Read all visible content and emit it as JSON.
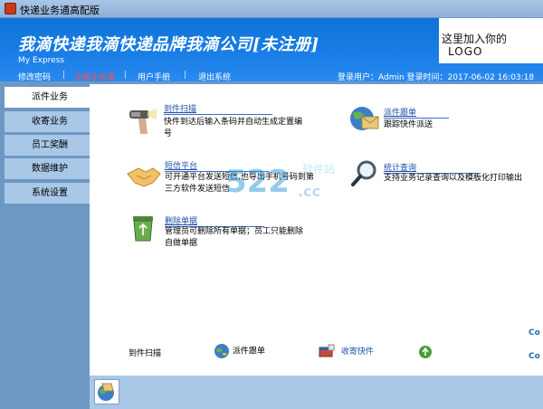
{
  "window": {
    "title": "快递业务通高配版"
  },
  "header": {
    "app_title": "我滴快递我滴快递品牌我滴公司[未注册]",
    "subtitle": "My Express",
    "logo_line1": "这里加入你的",
    "logo_line2": "LOGO"
  },
  "menu": {
    "items": [
      "修改密码",
      "注册业务通",
      "用户手册",
      "退出系统"
    ],
    "active_index": 1,
    "login_info": "登录用户：Admin  登录时间：2017-06-02 16:03:18"
  },
  "sidebar": {
    "items": [
      "派件业务",
      "收寄业务",
      "员工奖酬",
      "数据维护",
      "系统设置"
    ],
    "active_index": 0
  },
  "functions": [
    {
      "title": "到件扫描",
      "desc": "快件到达后输入条码并自动生成定置编号"
    },
    {
      "title": "派件跟单",
      "desc": "跟踪快件派送"
    },
    {
      "title": "短信平台",
      "desc": "可开通平台发送短信,也导出手机号码到第三方软件发送短信"
    },
    {
      "title": "统计查询",
      "desc": "支持业务记录查询以及模板化打印输出"
    },
    {
      "title": "删除单据",
      "desc": "管理员可删除所有单据；员工只能删除自做单据"
    }
  ],
  "quick_bar": [
    "到件扫描",
    "派件跟单",
    "收寄快件"
  ],
  "watermark": {
    "site": "软件站",
    "domain": ".cc"
  },
  "edge_text": [
    "Co",
    "Co"
  ],
  "colors": {
    "header_blue": "#1a7fe6",
    "active_menu": "#ff4b4b",
    "nav_bg": "#a9c8e8",
    "link_blue": "#1e4fa8"
  }
}
